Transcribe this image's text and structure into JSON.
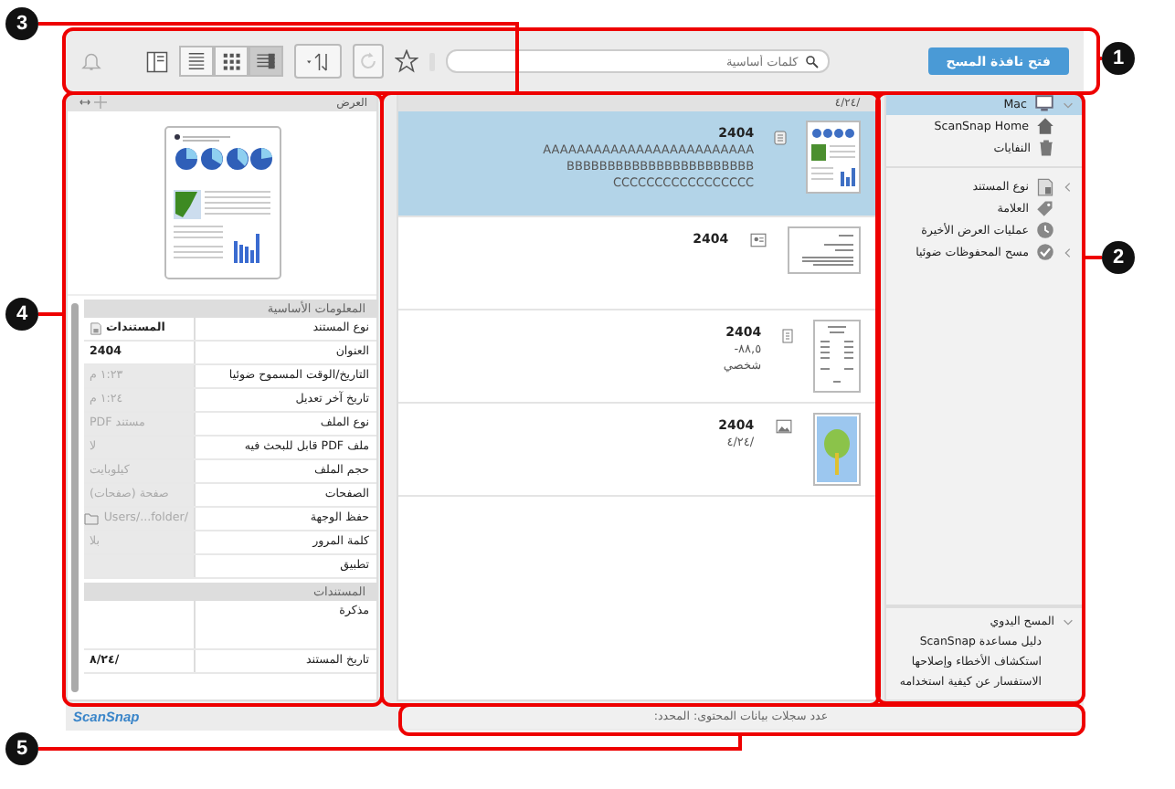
{
  "toolbar": {
    "scan_button": "فتح نافذة المسح",
    "search": {
      "placeholder": "كلمات أساسية"
    },
    "view_modes": [
      {
        "selected": true
      },
      {
        "selected": false
      },
      {
        "selected": false
      }
    ]
  },
  "sidebar": {
    "items": [
      {
        "label": "Mac",
        "kind": "computer",
        "selected": true,
        "expanded": true
      },
      {
        "label": "ScanSnap Home",
        "kind": "home",
        "selected": false
      },
      {
        "label": "النفايات",
        "kind": "trash",
        "selected": false
      }
    ],
    "groups": [
      {
        "label": "نوع المستند",
        "kind": "doctype",
        "selected": false,
        "expanded": false
      },
      {
        "label": "العلامة",
        "kind": "tag",
        "selected": false
      },
      {
        "label": "عمليات العرض الأخيرة",
        "kind": "recent",
        "selected": false
      },
      {
        "label": "مسح المحفوظات ضوئيا",
        "kind": "history",
        "selected": false,
        "expanded": false
      }
    ],
    "manual": {
      "label": "المسح اليدوي",
      "expanded": true,
      "links": [
        "دليل مساعدة ScanSnap",
        "استكشاف الأخطاء وإصلاحها",
        "الاستفسار عن كيفية استخدامه"
      ]
    }
  },
  "list": {
    "header": "/٤/٢٤",
    "records": [
      {
        "title": "2404",
        "kind": "document",
        "selected": true,
        "lines": [
          "AAAAAAAAAAAAAAAAAAAAAAAAA",
          "BBBBBBBBBBBBBBBBBBBBBBB",
          "CCCCCCCCCCCCCCCCC"
        ]
      },
      {
        "title": "2404",
        "kind": "card",
        "selected": false
      },
      {
        "title": "2404",
        "kind": "receipt",
        "selected": false,
        "lines": [
          "٨٨,٥-",
          "شخصي"
        ]
      },
      {
        "title": "2404",
        "kind": "photo",
        "selected": false,
        "lines": [
          "/٤/٢٤"
        ]
      }
    ]
  },
  "details": {
    "header": "العرض",
    "sections": [
      {
        "title": "المعلومات الأساسية",
        "rows": [
          {
            "label": "نوع المستند",
            "value": "المستندات",
            "kind": "doctype",
            "disabled": false
          },
          {
            "label": "العنوان",
            "value": "2404",
            "kind": "text",
            "disabled": false
          },
          {
            "label": "التاريخ/الوقت المسموح ضوئيا",
            "value": "١:٢٣ م",
            "kind": "text",
            "disabled": true
          },
          {
            "label": "تاريخ آخر تعديل",
            "value": "١:٢٤ م",
            "kind": "text",
            "disabled": true
          },
          {
            "label": "نوع الملف",
            "value": "مستند PDF",
            "kind": "text",
            "disabled": true
          },
          {
            "label": "ملف PDF قابل للبحث فيه",
            "value": "لا",
            "kind": "text",
            "disabled": true
          },
          {
            "label": "حجم الملف",
            "value": "كيلوبايت",
            "kind": "text",
            "disabled": true
          },
          {
            "label": "الصفحات",
            "value": "صفحة (صفحات)",
            "kind": "text",
            "disabled": true
          },
          {
            "label": "حفظ الوجهة",
            "value": "/Users/...folder",
            "kind": "folder",
            "disabled": true
          },
          {
            "label": "كلمة المرور",
            "value": "بلا",
            "kind": "text",
            "disabled": true
          },
          {
            "label": "تطبيق",
            "kind": "text",
            "disabled": true
          }
        ]
      },
      {
        "title": "المستندات",
        "rows": [
          {
            "label": "مذكرة",
            "kind": "memo"
          },
          {
            "label": "تاريخ المستند",
            "value": "/٨/٢٤",
            "kind": "text",
            "disabled": false
          }
        ]
      }
    ]
  },
  "status_bar": {
    "logo": "ScanSnap",
    "text": "عدد سجلات بيانات المحتوى:  المحدد:"
  },
  "annotations": [
    {
      "number": "1"
    },
    {
      "number": "2"
    },
    {
      "number": "3"
    },
    {
      "number": "4"
    },
    {
      "number": "5"
    }
  ]
}
